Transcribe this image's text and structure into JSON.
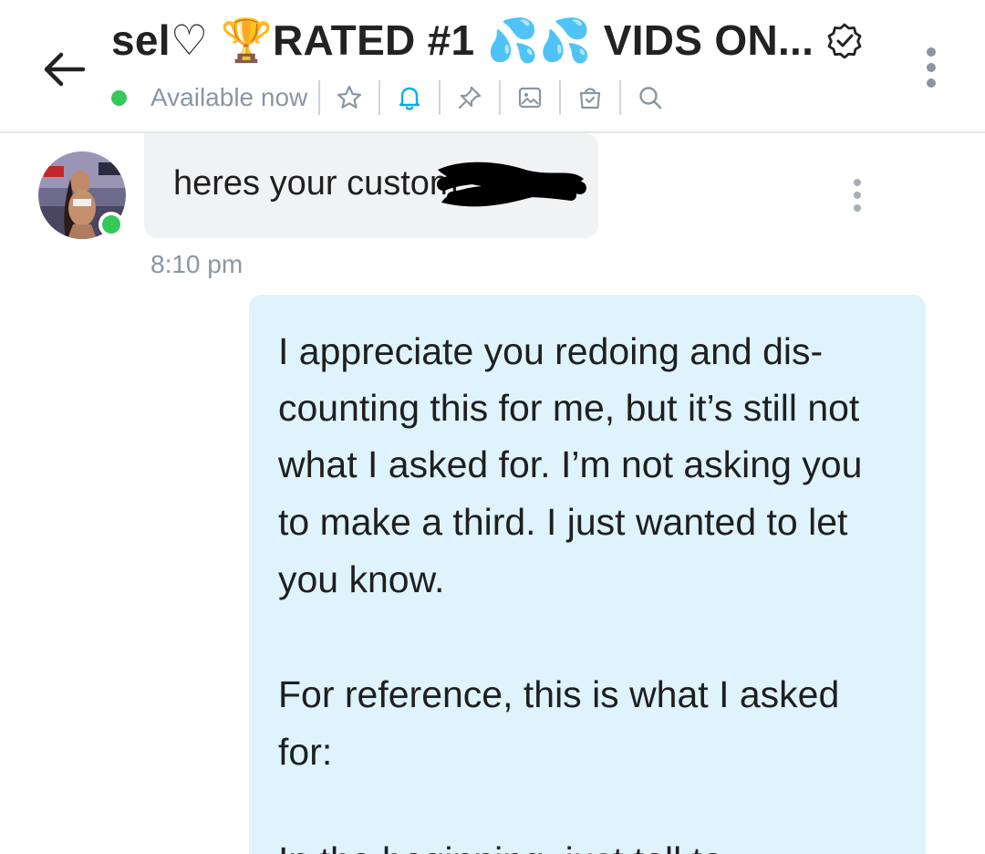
{
  "header": {
    "title": "sel♡ 🏆RATED #1 💦💦 VIDS ON...",
    "status": "Available now",
    "colors": {
      "online": "#34c759",
      "muted": "#8a96a3",
      "accent": "#00aff0"
    },
    "tools": [
      "star-icon",
      "bell-icon",
      "pin-icon",
      "image-icon",
      "bag-icon",
      "search-icon"
    ]
  },
  "messages": {
    "incoming": {
      "text": "heres your custom",
      "time": "8:10 pm"
    },
    "outgoing": {
      "lines": [
        "I appreciate you redoing and dis-",
        "counting this for me, but it’s still not",
        "what I asked for. I’m not asking you",
        "to make a third. I just wanted to let",
        "you know.",
        "",
        "For reference, this is what I asked",
        "for:",
        "",
        "In the beginning, just tell to"
      ]
    }
  }
}
